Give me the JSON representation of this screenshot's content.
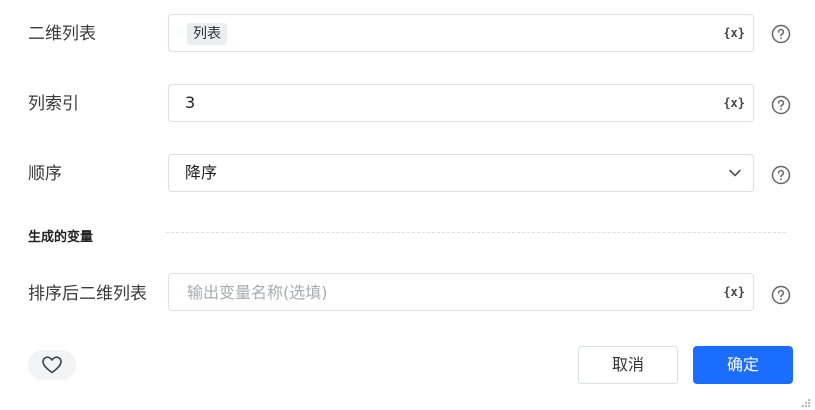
{
  "form": {
    "list_label": "二维列表",
    "list_tag": "列表",
    "column_index_label": "列索引",
    "column_index_value": "3",
    "order_label": "顺序",
    "order_value": "降序",
    "section_title": "生成的变量",
    "output_label": "排序后二维列表",
    "output_placeholder": "输出变量名称(选填)",
    "var_icon_text": "{x}"
  },
  "icons": {
    "help": "help-circle-icon",
    "variable": "variable-icon",
    "dropdown": "chevron-down-icon",
    "favorite": "heart-icon",
    "resize": "resize-grip-icon"
  },
  "footer": {
    "cancel_label": "取消",
    "confirm_label": "确定"
  },
  "colors": {
    "primary": "#1a6dff",
    "border": "#dcdfe6",
    "placeholder": "#a8abb2"
  }
}
